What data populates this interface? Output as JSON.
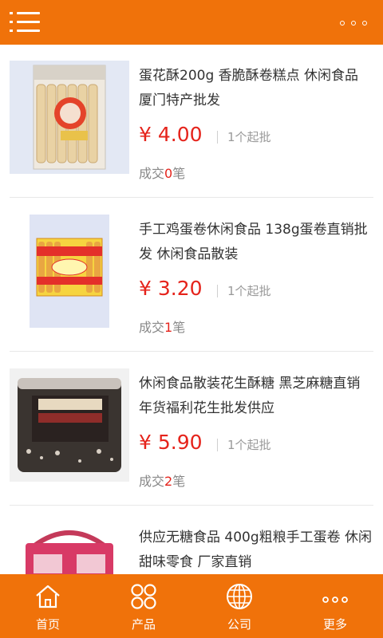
{
  "header": {
    "menu_icon": "menu-icon",
    "more_icon": "more-dots-icon"
  },
  "colors": {
    "brand_orange": "#f0720a",
    "price_red": "#e5231b"
  },
  "products": [
    {
      "title": "蛋花酥200g 香脆酥卷糕点 休闲食品 厦门特产批发",
      "price": "¥ 4.00",
      "min_order": "1个起批",
      "sold_prefix": "成交",
      "sold_count": "0",
      "sold_suffix": "笔"
    },
    {
      "title": "手工鸡蛋卷休闲食品 138g蛋卷直销批发 休闲食品散装",
      "price": "¥ 3.20",
      "min_order": "1个起批",
      "sold_prefix": "成交",
      "sold_count": "1",
      "sold_suffix": "笔"
    },
    {
      "title": "休闲食品散装花生酥糖 黑芝麻糖直销年货福利花生批发供应",
      "price": "¥ 5.90",
      "min_order": "1个起批",
      "sold_prefix": "成交",
      "sold_count": "2",
      "sold_suffix": "笔"
    },
    {
      "title": "供应无糖食品 400g粗粮手工蛋卷 休闲甜味零食 厂家直销",
      "price": "",
      "min_order": "",
      "sold_prefix": "",
      "sold_count": "",
      "sold_suffix": ""
    }
  ],
  "bottom_nav": [
    {
      "label": "首页",
      "icon": "home-icon"
    },
    {
      "label": "产品",
      "icon": "grid-icon"
    },
    {
      "label": "公司",
      "icon": "globe-icon"
    },
    {
      "label": "更多",
      "icon": "more-dots-icon"
    }
  ]
}
